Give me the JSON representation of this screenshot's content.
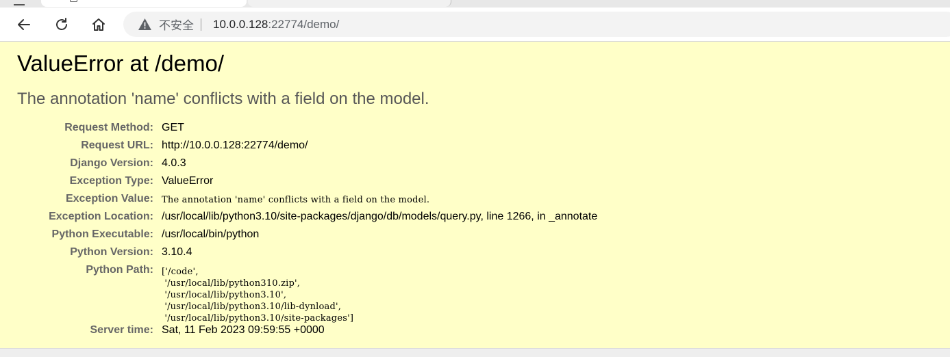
{
  "browser": {
    "security_label": "不安全",
    "url_host": "10.0.0.128",
    "url_rest": ":22774/demo/"
  },
  "error": {
    "title": "ValueError at /demo/",
    "message": "The annotation 'name' conflicts with a field on the model."
  },
  "meta": [
    {
      "key": "Request Method:",
      "value": "GET"
    },
    {
      "key": "Request URL:",
      "value": "http://10.0.0.128:22774/demo/"
    },
    {
      "key": "Django Version:",
      "value": "4.0.3"
    },
    {
      "key": "Exception Type:",
      "value": "ValueError"
    },
    {
      "key": "Exception Value:",
      "value": "The annotation 'name' conflicts with a field on the model."
    },
    {
      "key": "Exception Location:",
      "value": "/usr/local/lib/python3.10/site-packages/django/db/models/query.py, line 1266, in _annotate"
    },
    {
      "key": "Python Executable:",
      "value": "/usr/local/bin/python"
    },
    {
      "key": "Python Version:",
      "value": "3.10.4"
    },
    {
      "key": "Python Path:",
      "lines": [
        "['/code',",
        " '/usr/local/lib/python310.zip',",
        " '/usr/local/lib/python3.10',",
        " '/usr/local/lib/python3.10/lib-dynload',",
        " '/usr/local/lib/python3.10/site-packages']"
      ]
    },
    {
      "key": "Server time:",
      "value": "Sat, 11 Feb 2023 09:59:55 +0000"
    }
  ],
  "icons": {
    "back": "arrow-left-icon",
    "reload": "reload-icon",
    "home": "home-icon",
    "warning": "warning-triangle-icon"
  }
}
